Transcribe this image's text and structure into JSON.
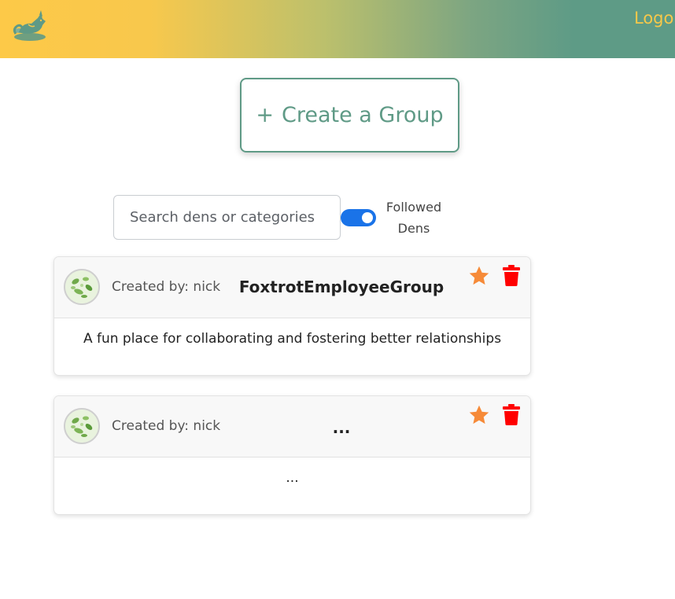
{
  "header": {
    "logo_label": "Logo"
  },
  "actions": {
    "create_plus": "+",
    "create_label": "Create a Group"
  },
  "search": {
    "placeholder": "Search dens or categories",
    "value": ""
  },
  "filter": {
    "toggle_on": true,
    "label": "Followed Dens"
  },
  "groups": [
    {
      "created_by": "Created by: nick",
      "name": "FoxtrotEmployeeGroup",
      "description": "A fun place for collaborating and fostering better relationships"
    },
    {
      "created_by": "Created by: nick",
      "name": "...",
      "description": "..."
    }
  ],
  "colors": {
    "accent": "#5f9a86",
    "toggle": "#1a73e8",
    "star": "#f68a38",
    "trash": "#ff0000"
  },
  "icons": {
    "logo": "fox-logo-icon",
    "favorite": "star-icon",
    "delete": "trash-icon"
  }
}
